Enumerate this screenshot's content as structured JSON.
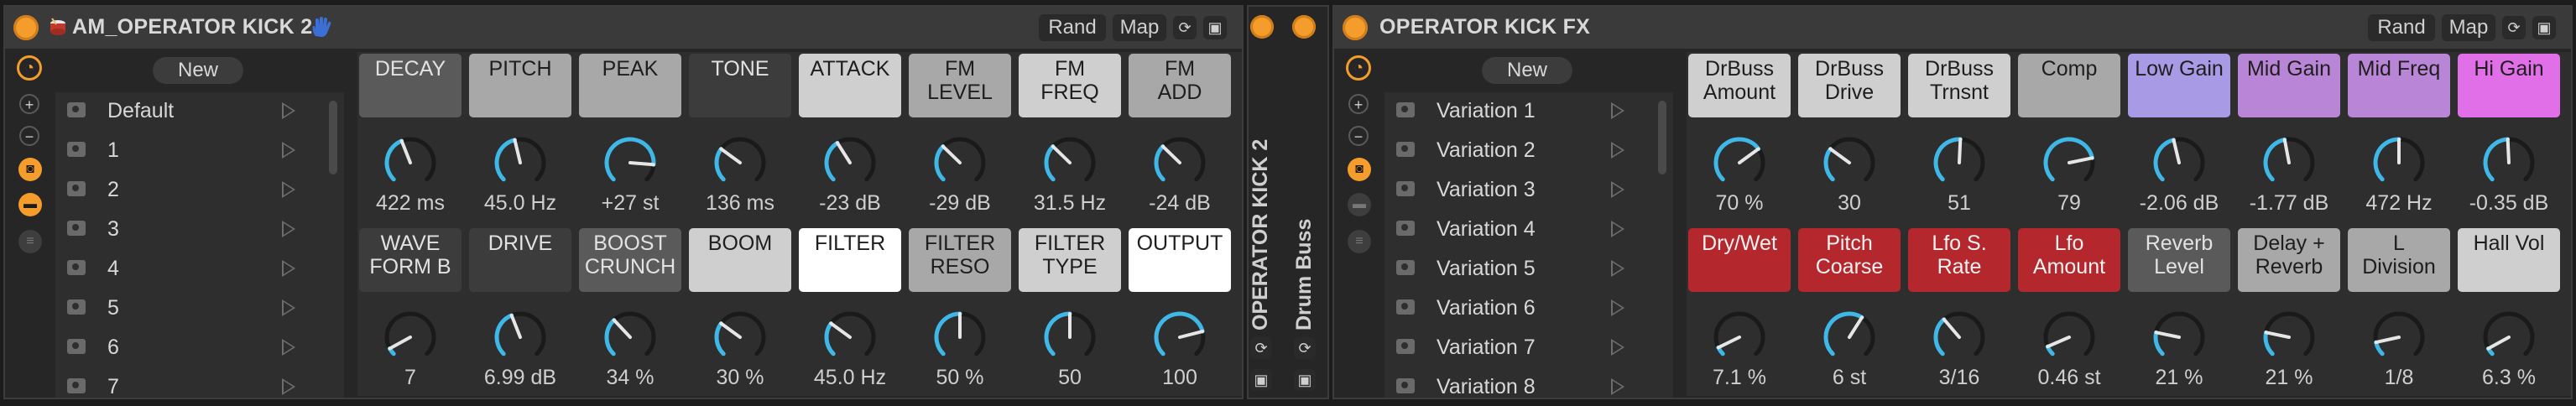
{
  "colors": {
    "accent": "#f59d2c",
    "knob_arc": "#3fb8e8",
    "bg": "#1c1c1c"
  },
  "left_rack": {
    "title": "AM_OPERATOR KICK 2",
    "title_prefix_icon": "drum-icon",
    "title_suffix_icon": "hand-icon",
    "rand_label": "Rand",
    "map_label": "Map",
    "new_label": "New",
    "variations": [
      "Default",
      "1",
      "2",
      "3",
      "4",
      "5",
      "6",
      "7"
    ],
    "macros": [
      {
        "label": "DECAY",
        "value": "422 ms",
        "level": 0.42,
        "bg": "#5a5a5a",
        "fg": "#e2e2e2"
      },
      {
        "label": "PITCH",
        "value": "45.0 Hz",
        "level": 0.45,
        "bg": "#a8a8a8",
        "fg": "#1e1e1e"
      },
      {
        "label": "PEAK",
        "value": "+27 st",
        "level": 0.85,
        "bg": "#a8a8a8",
        "fg": "#1e1e1e"
      },
      {
        "label": "TONE",
        "value": "136 ms",
        "level": 0.3,
        "bg": "#3c3c3c",
        "fg": "#e2e2e2"
      },
      {
        "label": "ATTACK",
        "value": "-23 dB",
        "level": 0.38,
        "bg": "#cfcfcf",
        "fg": "#1e1e1e"
      },
      {
        "label": "FM\nLEVEL",
        "value": "-29 dB",
        "level": 0.33,
        "bg": "#a8a8a8",
        "fg": "#1e1e1e"
      },
      {
        "label": "FM\nFREQ",
        "value": "31.5 Hz",
        "level": 0.33,
        "bg": "#cfcfcf",
        "fg": "#1e1e1e"
      },
      {
        "label": "FM\nADD",
        "value": "-24 dB",
        "level": 0.33,
        "bg": "#a8a8a8",
        "fg": "#1e1e1e"
      },
      {
        "label": "WAVE\nFORM B",
        "value": "7",
        "level": 0.06,
        "bg": "#3c3c3c",
        "fg": "#e2e2e2"
      },
      {
        "label": "DRIVE",
        "value": "6.99 dB",
        "level": 0.42,
        "bg": "#3c3c3c",
        "fg": "#e2e2e2"
      },
      {
        "label": "BOOST\nCRUNCH",
        "value": "34 %",
        "level": 0.34,
        "bg": "#5a5a5a",
        "fg": "#e2e2e2"
      },
      {
        "label": "BOOM",
        "value": "30 %",
        "level": 0.3,
        "bg": "#cfcfcf",
        "fg": "#1e1e1e"
      },
      {
        "label": "FILTER",
        "value": "45.0 Hz",
        "level": 0.3,
        "bg": "#ffffff",
        "fg": "#1e1e1e"
      },
      {
        "label": "FILTER\nRESO",
        "value": "50 %",
        "level": 0.5,
        "bg": "#a8a8a8",
        "fg": "#1e1e1e"
      },
      {
        "label": "FILTER\nTYPE",
        "value": "50",
        "level": 0.5,
        "bg": "#cfcfcf",
        "fg": "#1e1e1e"
      },
      {
        "label": "OUTPUT",
        "value": "100",
        "level": 0.78,
        "bg": "#ffffff",
        "fg": "#1e1e1e"
      }
    ]
  },
  "middle_strip": {
    "device_name": "OPERATOR KICK 2",
    "chain_name": "Drum Buss"
  },
  "right_rack": {
    "title": "OPERATOR KICK FX",
    "rand_label": "Rand",
    "map_label": "Map",
    "new_label": "New",
    "variations": [
      "Variation 1",
      "Variation 2",
      "Variation 3",
      "Variation 4",
      "Variation 5",
      "Variation 6",
      "Variation 7",
      "Variation 8"
    ],
    "macros": [
      {
        "label": "DrBuss\nAmount",
        "value": "70 %",
        "level": 0.7,
        "bg": "#cfcfcf",
        "fg": "#1e1e1e"
      },
      {
        "label": "DrBuss\nDrive",
        "value": "30",
        "level": 0.3,
        "bg": "#cfcfcf",
        "fg": "#1e1e1e"
      },
      {
        "label": "DrBuss\nTrnsnt",
        "value": "51",
        "level": 0.51,
        "bg": "#cfcfcf",
        "fg": "#1e1e1e"
      },
      {
        "label": "Comp",
        "value": "79",
        "level": 0.79,
        "bg": "#a8a8a8",
        "fg": "#1e1e1e"
      },
      {
        "label": "Low Gain",
        "value": "-2.06 dB",
        "level": 0.45,
        "bg": "#a99ae6",
        "fg": "#1e1e1e"
      },
      {
        "label": "Mid Gain",
        "value": "-1.77 dB",
        "level": 0.46,
        "bg": "#b985d6",
        "fg": "#1e1e1e"
      },
      {
        "label": "Mid Freq",
        "value": "472 Hz",
        "level": 0.5,
        "bg": "#b985d6",
        "fg": "#1e1e1e"
      },
      {
        "label": "Hi Gain",
        "value": "-0.35 dB",
        "level": 0.49,
        "bg": "#e06fe8",
        "fg": "#1e1e1e"
      },
      {
        "label": "Dry/Wet",
        "value": "7.1 %",
        "level": 0.07,
        "bg": "#b3272d",
        "fg": "#f2f2f2"
      },
      {
        "label": "Pitch\nCoarse",
        "value": "6 st",
        "level": 0.62,
        "bg": "#b3272d",
        "fg": "#f2f2f2"
      },
      {
        "label": "Lfo S.\nRate",
        "value": "3/16",
        "level": 0.35,
        "bg": "#b3272d",
        "fg": "#f2f2f2"
      },
      {
        "label": "Lfo\nAmount",
        "value": "0.46 st",
        "level": 0.08,
        "bg": "#b3272d",
        "fg": "#f2f2f2"
      },
      {
        "label": "Reverb\nLevel",
        "value": "21 %",
        "level": 0.21,
        "bg": "#5a5a5a",
        "fg": "#e2e2e2"
      },
      {
        "label": "Delay +\nReverb",
        "value": "21 %",
        "level": 0.21,
        "bg": "#a8a8a8",
        "fg": "#1e1e1e"
      },
      {
        "label": "L\nDivision",
        "value": "1/8",
        "level": 0.12,
        "bg": "#a8a8a8",
        "fg": "#1e1e1e"
      },
      {
        "label": "Hall Vol",
        "value": "6.3 %",
        "level": 0.06,
        "bg": "#cfcfcf",
        "fg": "#1e1e1e"
      }
    ]
  }
}
